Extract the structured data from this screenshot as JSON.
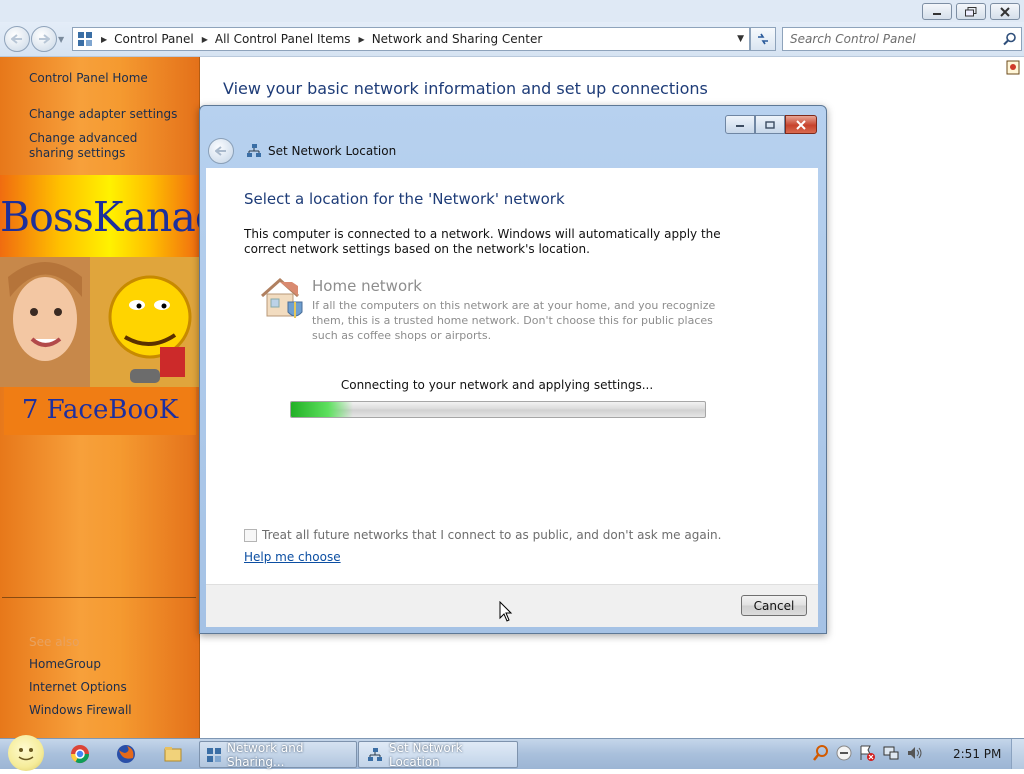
{
  "explorer": {
    "breadcrumbs": [
      "Control Panel",
      "All Control Panel Items",
      "Network and Sharing Center"
    ],
    "search_placeholder": "Search Control Panel",
    "main_title": "View your basic network information and set up connections"
  },
  "sidebar": {
    "home": "Control Panel Home",
    "link_adapter": "Change adapter settings",
    "link_sharing": "Change advanced sharing settings",
    "banner_top": "BossKanae",
    "banner_bottom": "7 FaceBooK",
    "see_also_label": "See also",
    "see_also": [
      "HomeGroup",
      "Internet Options",
      "Windows Firewall"
    ]
  },
  "dialog": {
    "title": "Set Network Location",
    "heading": "Select a location for the 'Network' network",
    "description": "This computer is connected to a network. Windows will automatically apply the correct network settings based on the network's location.",
    "option_title": "Home network",
    "option_description": "If all the computers on this network are at your home, and you recognize them, this is a trusted home network.  Don't choose this for public places such as coffee shops or airports.",
    "progress_text": "Connecting to your network and applying settings...",
    "progress_fraction": 0.15,
    "checkbox_label": "Treat all future networks that I connect to as public, and don't ask me again.",
    "checkbox_checked": false,
    "help_link": "Help me choose",
    "cancel_label": "Cancel"
  },
  "taskbar": {
    "tasks": [
      "Network and Sharing...",
      "Set Network Location"
    ],
    "clock": "2:51 PM"
  },
  "colors": {
    "accent_blue": "#1e3c78",
    "progress_green": "#22b026",
    "sidebar_orange": "#f59a30"
  }
}
